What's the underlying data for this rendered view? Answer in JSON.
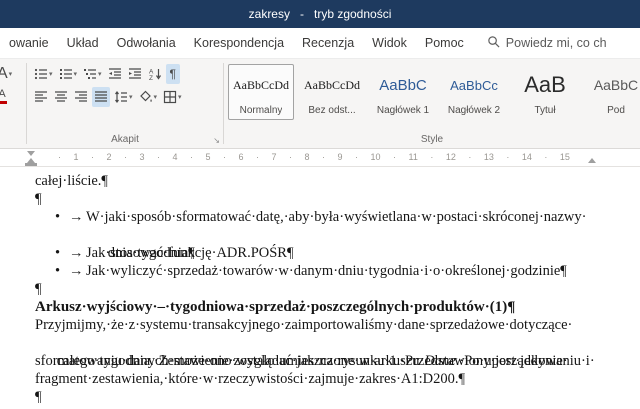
{
  "colors": {
    "title_bar": "#1e3a5f",
    "heading_style_blue": "#2e5b97",
    "active_toggle": "#cde0f2"
  },
  "title_bar": {
    "title": "zakresy   -   tryb zgodności"
  },
  "tabs": [
    {
      "label": "owanie"
    },
    {
      "label": "Układ"
    },
    {
      "label": "Odwołania"
    },
    {
      "label": "Korespondencja"
    },
    {
      "label": "Recenzja"
    },
    {
      "label": "Widok"
    },
    {
      "label": "Pomoc"
    }
  ],
  "search": {
    "label": "Powiedz mi, co ch",
    "icon": "search-icon"
  },
  "ribbon": {
    "paragraph_group_label": "Akapit",
    "styles_group_label": "Style",
    "icons": {
      "pilcrow": "¶",
      "dropdown": "▾",
      "dialog_launcher": "↘",
      "sort_a": "A",
      "sort_z": "Z",
      "font_partial": "A"
    }
  },
  "styles": {
    "items": [
      {
        "sample": "AaBbCcDd",
        "name": "Normalny"
      },
      {
        "sample": "AaBbCcDd",
        "name": "Bez odst..."
      },
      {
        "sample": "AaBbC",
        "name": "Nagłówek 1"
      },
      {
        "sample": "AaBbCc",
        "name": "Nagłówek 2"
      },
      {
        "sample": "AaB",
        "name": "Tytuł"
      },
      {
        "sample": "AaBbC",
        "name": "Pod"
      }
    ]
  },
  "ruler": {
    "marks": "· 1 · 2 · 3 · 4 · 5 · 6 · 7 · 8 · 9 · 10 · 11 · 12 · 13 · 14 · 15"
  },
  "document": {
    "line_top": "całej·liście.¶",
    "pilcrow": "¶",
    "bullets": {
      "marker": "•",
      "tab_arrow": "→",
      "item1_line1": "W·jaki·sposób·sformatować·datę,·aby·była·wyświetlana·w·postaci·skróconej·nazwy·",
      "item1_line2": "dnia·tygodnia¶",
      "item2": "Jak·stosować·funkcję·ADR.POŚR¶",
      "item3": "Jak·wyliczyć·sprzedaż·towarów·w·danym·dniu·tygodnia·i·o·określonej·godzinie¶"
    },
    "heading": "Arkusz·wyjściowy·–·tygodniowa·sprzedaż·poszczególnych·produktów·(1)¶",
    "para": {
      "line1": "Przyjmijmy,·że·z·systemu·transakcyjnego·zaimportowaliśmy·dane·sprzedażowe·dotyczące·",
      "line2_pre": "całego·tygodnia.·Zestawienie·zostało·umieszczone·w·arkuszu·",
      "line2_italic": "Dane",
      "line2_post": ".·Po·uporządkowaniu·i·",
      "line3": "sformatowaniu·danych·może·ono·wyglądać·jak·na·rysunku·1.·Przedstawiony·jest·jedynie·",
      "line4": "fragment·zestawienia,·które·w·rzeczywistości·zajmuje·zakres·A1:D200.¶"
    }
  }
}
